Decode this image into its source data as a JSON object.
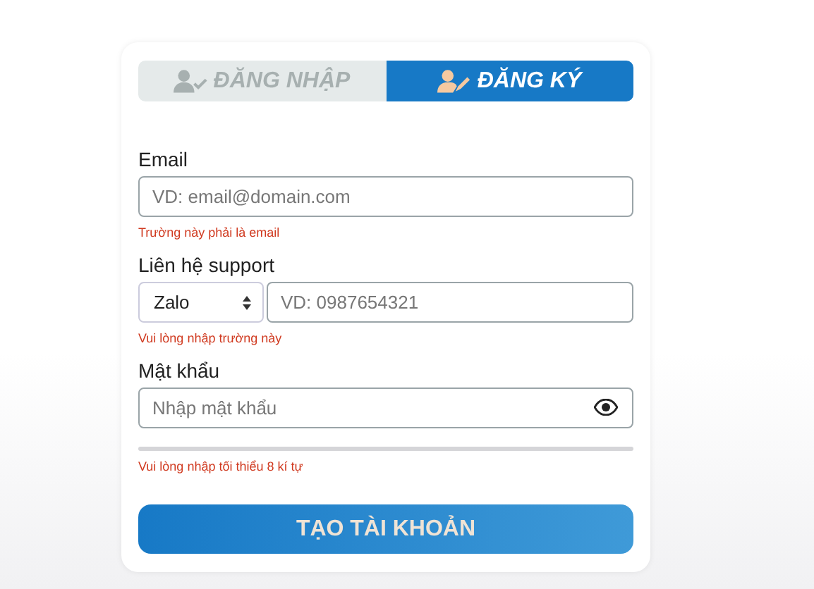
{
  "tabs": [
    {
      "label": "ĐĂNG NHẬP",
      "selected": false
    },
    {
      "label": "ĐĂNG KÝ",
      "selected": true
    }
  ],
  "email": {
    "label": "Email",
    "placeholder": "VD: email@domain.com",
    "error": "Trường này phải là email"
  },
  "support": {
    "label": "Liên hệ support",
    "channel": "Zalo",
    "placeholder": "VD: 0987654321",
    "error": "Vui lòng nhập trường này"
  },
  "password": {
    "label": "Mật khẩu",
    "placeholder": "Nhập mật khẩu",
    "strength": {
      "level": 0
    },
    "error": "Vui lòng nhập tối thiểu 8 kí tự"
  },
  "submit": "TẠO TÀI KHOẢN"
}
